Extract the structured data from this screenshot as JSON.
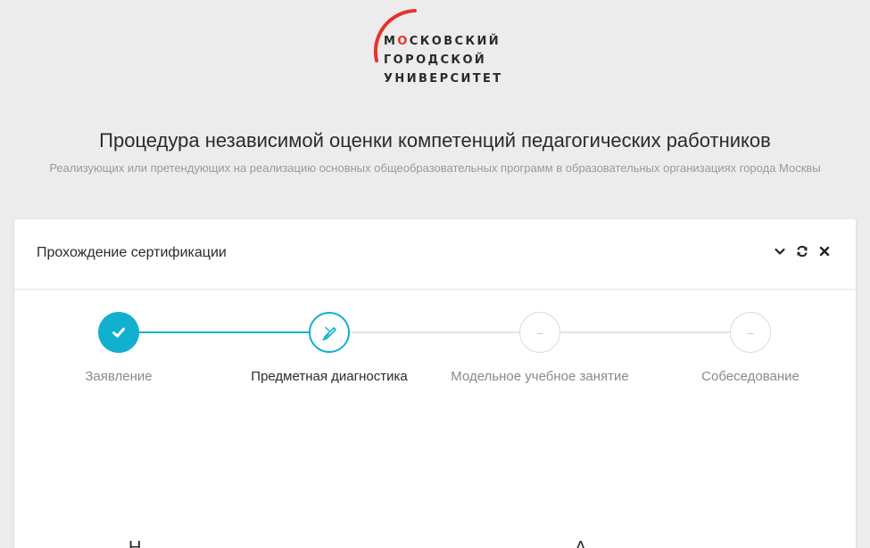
{
  "logo": {
    "lines": [
      "МОСКОВСКИЙ",
      "ГОРОДСКОЙ",
      "УНИВЕРСИТЕТ"
    ],
    "accent_color": "#e8322b"
  },
  "title": "Процедура независимой оценки компетенций педагогических работников",
  "subtitle": "Реализующих или претендующих на реализацию основных общеобразовательных программ в образовательных организациях города Москвы",
  "card": {
    "title": "Прохождение сертификации",
    "tools": [
      "chevron-down-icon",
      "refresh-icon",
      "close-icon"
    ]
  },
  "stepper": {
    "accent_color": "#12b0cf",
    "steps": [
      {
        "label": "Заявление",
        "state": "done",
        "icon": "check-icon"
      },
      {
        "label": "Предметная диагностика",
        "state": "active",
        "icon": "pencil-icon"
      },
      {
        "label": "Модельное учебное занятие",
        "state": "pending",
        "icon": "–"
      },
      {
        "label": "Собеседование",
        "state": "pending",
        "icon": "–"
      }
    ]
  },
  "bottom": {
    "left": "Н",
    "right": "А"
  }
}
